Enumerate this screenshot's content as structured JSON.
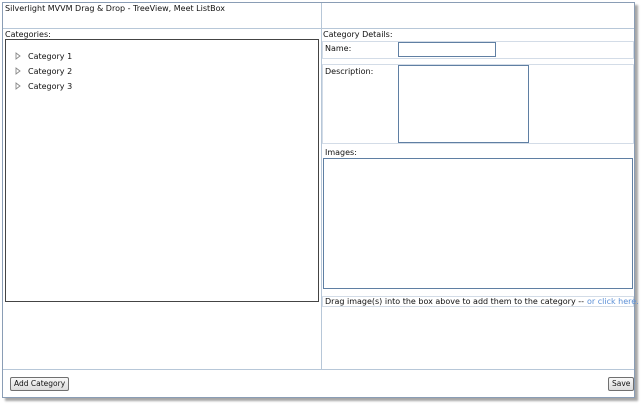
{
  "window": {
    "title": "Silverlight MVVM Drag & Drop - TreeView, Meet ListBox"
  },
  "categories_panel": {
    "label": "Categories:",
    "items": [
      {
        "label": "Category 1",
        "icon": "expand-arrow-icon"
      },
      {
        "label": "Category 2",
        "icon": "expand-arrow-icon"
      },
      {
        "label": "Category 3",
        "icon": "expand-arrow-icon"
      }
    ]
  },
  "details_panel": {
    "label": "Category Details:",
    "name_label": "Name:",
    "name_value": "",
    "description_label": "Description:",
    "description_value": "",
    "images_label": "Images:",
    "drag_hint": "Drag image(s) into the box above to add them to the category --",
    "click_link": "or click here."
  },
  "footer": {
    "add_category_label": "Add Category",
    "save_label": "Save"
  },
  "colors": {
    "border": "#8a9db5",
    "divider": "#b7c7d8",
    "link": "#5b8fd6",
    "input_border": "#5f7fa3"
  }
}
